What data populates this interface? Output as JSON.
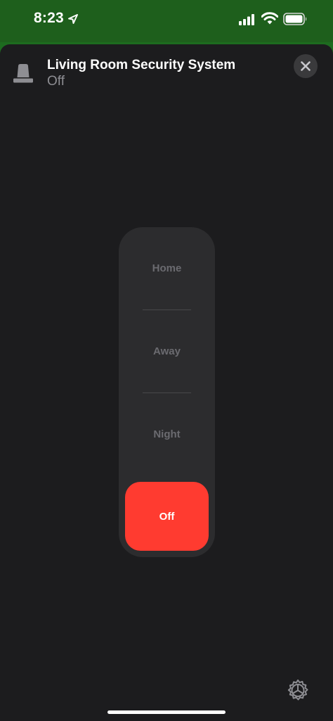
{
  "status_bar": {
    "time": "8:23",
    "icons": [
      "location-arrow-icon",
      "cellular-signal-icon",
      "wifi-icon",
      "battery-icon"
    ]
  },
  "header": {
    "title": "Living Room Security System",
    "status": "Off",
    "device_icon": "security-siren-icon",
    "close_icon": "close-icon"
  },
  "modes": {
    "options": [
      "Home",
      "Away",
      "Night",
      "Off"
    ],
    "selected": "Off"
  },
  "footer": {
    "settings_icon": "gear-icon"
  },
  "colors": {
    "status_bar_bg": "#1e5f1c",
    "sheet_bg": "#1c1c1e",
    "selector_bg": "#2c2c2e",
    "active_mode": "#ff3b30",
    "inactive_text": "#6b6b70"
  }
}
